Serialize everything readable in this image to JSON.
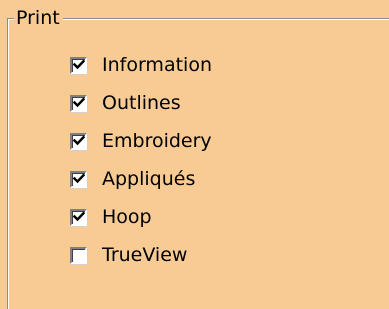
{
  "group": {
    "title": "Print"
  },
  "options": [
    {
      "label": "Information",
      "checked": true
    },
    {
      "label": "Outlines",
      "checked": true
    },
    {
      "label": "Embroidery",
      "checked": true
    },
    {
      "label": "Appliqués",
      "checked": true
    },
    {
      "label": "Hoop",
      "checked": true
    },
    {
      "label": "TrueView",
      "checked": false
    }
  ],
  "colors": {
    "background": "#F7CB93",
    "text": "#000000",
    "checkbox_bg": "#FFFFFF",
    "check_mark": "#000000"
  }
}
